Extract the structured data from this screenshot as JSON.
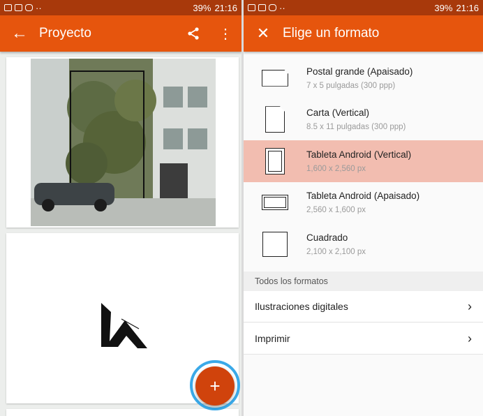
{
  "status": {
    "battery": "39%",
    "time": "21:16"
  },
  "left": {
    "title": "Proyecto",
    "back_icon": "arrow-back-icon",
    "fab_label": "+"
  },
  "right": {
    "title": "Elige un formato",
    "formats": [
      {
        "name": "Postal grande (Apaisado)",
        "dims": "7 x 5 pulgadas (300 ppp)",
        "shape": "landscape-wide"
      },
      {
        "name": "Carta (Vertical)",
        "dims": "8.5 x 11 pulgadas (300 ppp)",
        "shape": "portrait-doc"
      },
      {
        "name": "Tableta Android (Vertical)",
        "dims": "1,600 x 2,560 px",
        "shape": "tablet-portrait"
      },
      {
        "name": "Tableta Android (Apaisado)",
        "dims": "2,560 x 1,600 px",
        "shape": "tablet-landscape"
      },
      {
        "name": "Cuadrado",
        "dims": "2,100 x 2,100 px",
        "shape": "square"
      }
    ],
    "selected_index": 2,
    "section_header": "Todos los formatos",
    "categories": [
      "Ilustraciones digitales",
      "Imprimir"
    ]
  },
  "colors": {
    "accent": "#e6550d",
    "selected_row": "#f2bdb0",
    "fab": "#d0430c",
    "highlight_ring": "#3aa9e8"
  }
}
